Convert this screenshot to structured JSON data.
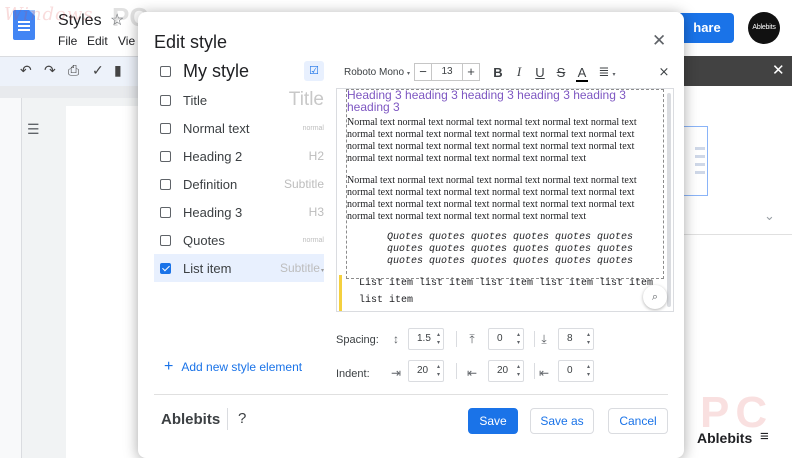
{
  "docs": {
    "title": "Styles",
    "menu": [
      "File",
      "Edit",
      "Vie"
    ],
    "share_label": "hare",
    "avatar_label": "Ablebits"
  },
  "watermark": {
    "left": "Windows",
    "pc": "PC"
  },
  "sidebar": {
    "brand": "Ablebits"
  },
  "dialog": {
    "title": "Edit style",
    "styles": [
      {
        "name": "My style",
        "hint": "",
        "checked": false
      },
      {
        "name": "Title",
        "hint": "Title",
        "checked": false
      },
      {
        "name": "Normal text",
        "hint": "normal",
        "checked": false
      },
      {
        "name": "Heading 2",
        "hint": "H2",
        "checked": false
      },
      {
        "name": "Definition",
        "hint": "Subtitle",
        "checked": false
      },
      {
        "name": "Heading 3",
        "hint": "H3",
        "checked": false
      },
      {
        "name": "Quotes",
        "hint": "normal",
        "checked": false
      },
      {
        "name": "List item",
        "hint": "Subtitle",
        "checked": true
      }
    ],
    "add_element_label": "Add new style element",
    "toolbar": {
      "font": "Roboto Mono",
      "font_size": "13",
      "bold": "B",
      "italic": "I",
      "underline": "U",
      "strike": "S",
      "text_color": "A"
    },
    "preview": {
      "heading3": "Heading 3 heading 3 heading 3 heading 3 heading 3 heading 3",
      "normal_1": "Normal text normal text normal text normal text normal text normal text normal text normal text normal text normal text normal text normal text normal text normal text normal text normal text normal text normal text normal text normal text normal text normal text normal text",
      "normal_2": "Normal text normal text normal text normal text normal text normal text normal text normal text normal text normal text normal text normal text normal text normal text normal text normal text normal text normal text normal text normal text normal text normal text normal text",
      "quotes": "Quotes quotes quotes quotes quotes quotes quotes quotes quotes quotes quotes quotes quotes quotes quotes quotes quotes quotes",
      "list": "List item list item list item list item list item list item"
    },
    "spacing": {
      "label": "Spacing:",
      "line": "1.5",
      "before": "0",
      "after": "8"
    },
    "indent": {
      "label": "Indent:",
      "left": "20",
      "first_line": "20",
      "right": "0"
    },
    "footer": {
      "brand": "Ablebits",
      "help": "?",
      "save": "Save",
      "save_as": "Save as",
      "cancel": "Cancel"
    },
    "colors": {
      "accent": "#1a73e8",
      "heading3": "#7e57c2",
      "list_marker": "#f4d03f"
    }
  }
}
